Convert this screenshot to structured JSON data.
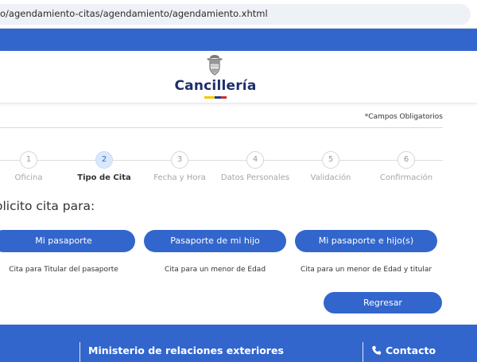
{
  "browser": {
    "url": "o/agendamiento-citas/agendamiento/agendamiento.xhtml"
  },
  "header": {
    "brand_name": "Cancillería",
    "logo_icon": "coat-of-arms-icon",
    "flag_colors": [
      "#f6c700",
      "#1e3c8c",
      "#d52b1e"
    ],
    "gov_bar_color": "#3366cc"
  },
  "form": {
    "required_note": "*Campos Obligatorios",
    "question": "olicito cita para:",
    "steps": [
      {
        "number": "1",
        "label": "Oficina",
        "state": "pending"
      },
      {
        "number": "2",
        "label": "Tipo de Cita",
        "state": "active"
      },
      {
        "number": "3",
        "label": "Fecha y Hora",
        "state": "pending"
      },
      {
        "number": "4",
        "label": "Datos Personales",
        "state": "pending"
      },
      {
        "number": "5",
        "label": "Validación",
        "state": "pending"
      },
      {
        "number": "6",
        "label": "Confirmación",
        "state": "pending"
      }
    ],
    "options": [
      {
        "label": "Mi pasaporte",
        "description": "Cita para Titular del pasaporte"
      },
      {
        "label": "Pasaporte de mi hijo",
        "description": "Cita para un menor de Edad"
      },
      {
        "label": "Mi pasaporte e hijo(s)",
        "description": "Cita para un menor de Edad y titular"
      }
    ],
    "back_label": "Regresar",
    "accent_color": "#3366cc"
  },
  "footer": {
    "ministry": "Ministerio de relaciones exteriores",
    "contact": "Contacto",
    "contact_icon": "phone-icon"
  }
}
